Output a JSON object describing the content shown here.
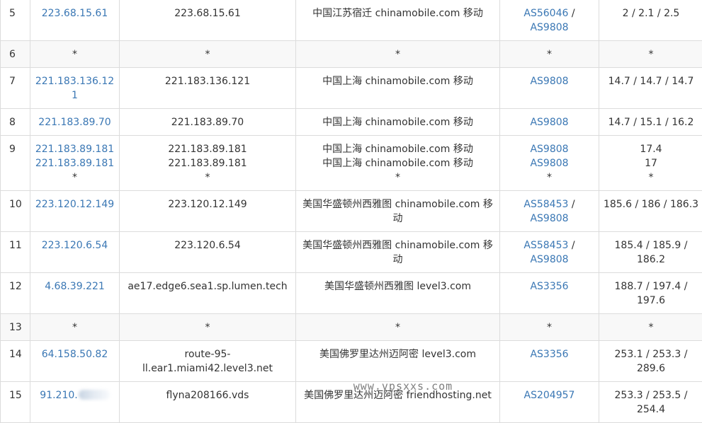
{
  "rows": [
    {
      "hop": "5",
      "ip": [
        "223.68.15.61"
      ],
      "host": [
        "223.68.15.61"
      ],
      "geo": [
        "中国江苏宿迁 chinamobile.com 移动"
      ],
      "asn": [
        [
          "AS56046",
          " /"
        ],
        [
          "AS9808"
        ]
      ],
      "time": [
        "2 / 2.1 / 2.5"
      ],
      "alt": false
    },
    {
      "hop": "6",
      "ip": [
        "*"
      ],
      "host": [
        "*"
      ],
      "geo": [
        "*"
      ],
      "asn": [
        [
          "*"
        ]
      ],
      "time": [
        "*"
      ],
      "alt": true
    },
    {
      "hop": "7",
      "ip": [
        "221.183.136.121"
      ],
      "host": [
        "221.183.136.121"
      ],
      "geo": [
        "中国上海 chinamobile.com 移动"
      ],
      "asn": [
        [
          "AS9808"
        ]
      ],
      "time": [
        "14.7 / 14.7 / 14.7"
      ],
      "alt": false
    },
    {
      "hop": "8",
      "ip": [
        "221.183.89.70"
      ],
      "host": [
        "221.183.89.70"
      ],
      "geo": [
        "中国上海 chinamobile.com 移动"
      ],
      "asn": [
        [
          "AS9808"
        ]
      ],
      "time": [
        "14.7 / 15.1 / 16.2"
      ],
      "alt": false
    },
    {
      "hop": "9",
      "ip": [
        "221.183.89.181",
        "221.183.89.181",
        "*"
      ],
      "host": [
        "221.183.89.181",
        "221.183.89.181",
        "*"
      ],
      "geo": [
        "中国上海 chinamobile.com 移动",
        "中国上海 chinamobile.com 移动",
        "*"
      ],
      "asn": [
        [
          "AS9808"
        ],
        [
          "AS9808"
        ],
        [
          "*"
        ]
      ],
      "time": [
        "17.4",
        "17",
        "*"
      ],
      "alt": false
    },
    {
      "hop": "10",
      "ip": [
        "223.120.12.149"
      ],
      "host": [
        "223.120.12.149"
      ],
      "geo": [
        "美国华盛顿州西雅图 chinamobile.com 移",
        "动"
      ],
      "asn": [
        [
          "AS58453",
          " /"
        ],
        [
          "AS9808"
        ]
      ],
      "time": [
        "185.6 / 186 / 186.3"
      ],
      "alt": false
    },
    {
      "hop": "11",
      "ip": [
        "223.120.6.54"
      ],
      "host": [
        "223.120.6.54"
      ],
      "geo": [
        "美国华盛顿州西雅图 chinamobile.com 移",
        "动"
      ],
      "asn": [
        [
          "AS58453",
          " /"
        ],
        [
          "AS9808"
        ]
      ],
      "time": [
        "185.4 / 185.9 /",
        "186.2"
      ],
      "alt": false
    },
    {
      "hop": "12",
      "ip": [
        "4.68.39.221"
      ],
      "host": [
        "ae17.edge6.sea1.sp.lumen.tech"
      ],
      "geo": [
        "美国华盛顿州西雅图 level3.com"
      ],
      "asn": [
        [
          "AS3356"
        ]
      ],
      "time": [
        "188.7 / 197.4 /",
        "197.6"
      ],
      "alt": false
    },
    {
      "hop": "13",
      "ip": [
        "*"
      ],
      "host": [
        "*"
      ],
      "geo": [
        "*"
      ],
      "asn": [
        [
          "*"
        ]
      ],
      "time": [
        "*"
      ],
      "alt": true
    },
    {
      "hop": "14",
      "ip": [
        "64.158.50.82"
      ],
      "host": [
        "route-95-",
        "ll.ear1.miami42.level3.net"
      ],
      "geo": [
        "美国佛罗里达州迈阿密 level3.com"
      ],
      "asn": [
        [
          "AS3356"
        ]
      ],
      "time": [
        "253.1 / 253.3 /",
        "289.6"
      ],
      "alt": false
    },
    {
      "hop": "15",
      "ip": [
        "91.210."
      ],
      "ip_masked": true,
      "host": [
        "flyna208166.vds"
      ],
      "geo": [
        "美国佛罗里达州迈阿密 friendhosting.net"
      ],
      "asn": [
        [
          "AS204957"
        ]
      ],
      "time": [
        "253.3 / 253.5 /",
        "254.4"
      ],
      "alt": false
    }
  ],
  "watermark": "www.vpsxxs.com",
  "colors": {
    "link": "#3a77b4",
    "text": "#333333",
    "border": "#dcdcdc",
    "alt_row": "#f8f8f8"
  }
}
